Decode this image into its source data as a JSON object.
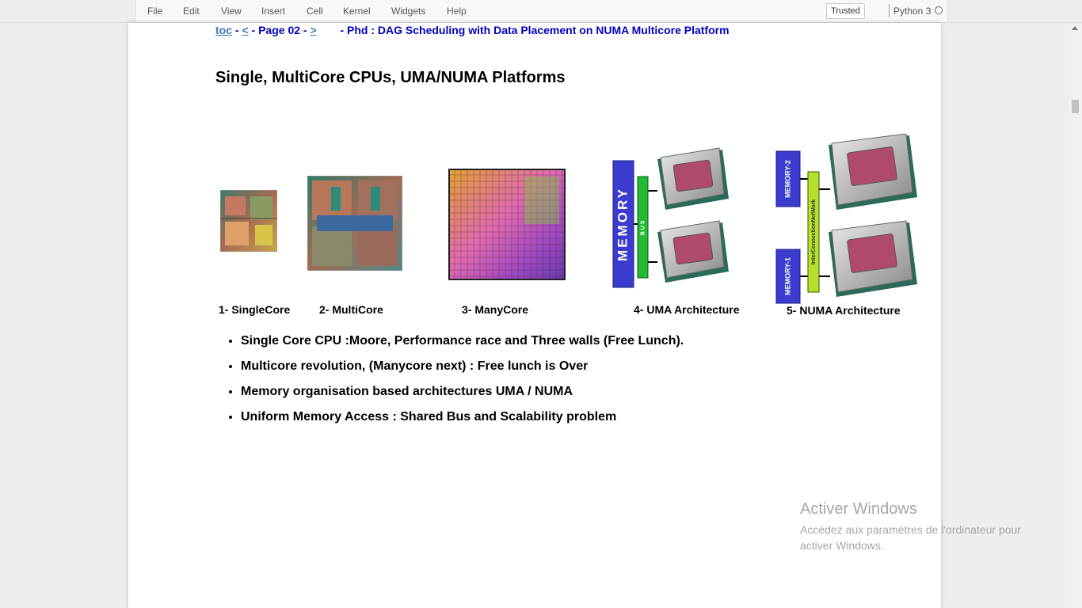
{
  "menu": {
    "items": [
      "File",
      "Edit",
      "View",
      "Insert",
      "Cell",
      "Kernel",
      "Widgets",
      "Help"
    ],
    "trusted_label": "Trusted",
    "kernel_name": "Python 3"
  },
  "nav": {
    "toc": "toc",
    "prev": "<",
    "page": "Page 02",
    "next": ">",
    "sep": "-",
    "subtitle": "- Phd : DAG Scheduling with Data Placement on NUMA Multicore Platform"
  },
  "title": "Single, MultiCore CPUs, UMA/NUMA Platforms",
  "figures": {
    "captions": [
      "1- SingleCore",
      "2- MultiCore",
      "3- ManyCore",
      "4- UMA Architecture",
      "5- NUMA Architecture"
    ],
    "uma_memory_label": "MEMORY",
    "uma_bus_label": "BUS",
    "numa_memory2_label": "MEMORY-2",
    "numa_memory1_label": "MEMORY-1",
    "numa_network_label": "InterConnectionNetWork"
  },
  "bullets": [
    "Single Core CPU :Moore, Performance race and Three walls (Free Lunch).",
    "Multicore revolution, (Manycore next) : Free lunch is Over",
    "Memory organisation based architectures UMA / NUMA",
    "Uniform Memory Access : Shared Bus and Scalability problem"
  ],
  "watermark": {
    "title": "Activer Windows",
    "text": "Accédez aux paramètres de l'ordinateur pour activer Windows."
  }
}
